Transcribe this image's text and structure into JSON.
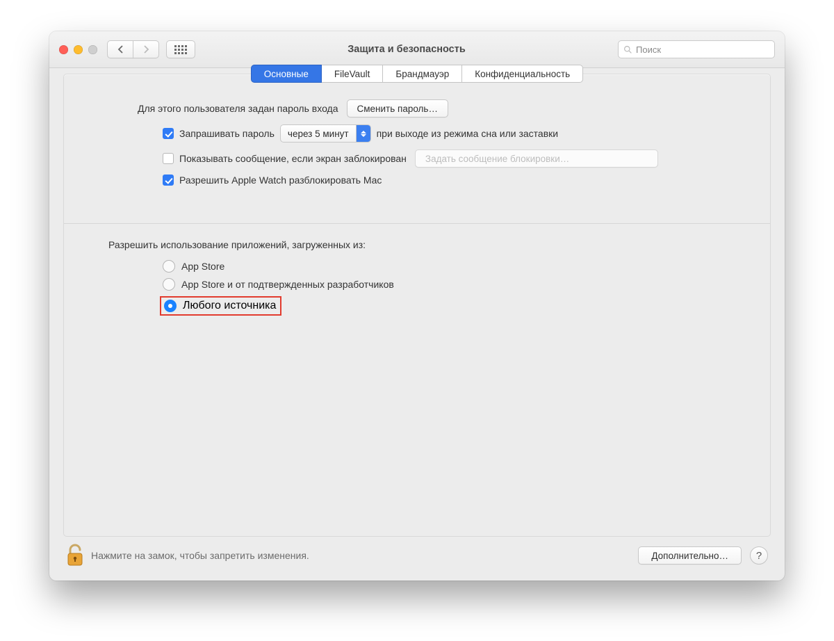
{
  "window": {
    "title": "Защита и безопасность"
  },
  "search": {
    "placeholder": "Поиск"
  },
  "tabs": [
    "Основные",
    "FileVault",
    "Брандмауэр",
    "Конфиденциальность"
  ],
  "general": {
    "password_set_label": "Для этого пользователя задан пароль входа",
    "change_password_button": "Сменить пароль…",
    "require_password_label": "Запрашивать пароль",
    "require_delay": "через 5 минут",
    "require_password_suffix": "при выходе из режима сна или заставки",
    "show_message_label": "Показывать сообщение, если экран заблокирован",
    "set_lock_message_button": "Задать сообщение блокировки…",
    "allow_watch_label": "Разрешить Apple Watch разблокировать Mac"
  },
  "allow_apps": {
    "title": "Разрешить использование приложений, загруженных из:",
    "options": [
      "App Store",
      "App Store и от подтвержденных разработчиков",
      "Любого источника"
    ]
  },
  "footer": {
    "lock_hint": "Нажмите на замок, чтобы запретить изменения.",
    "advanced_button": "Дополнительно…",
    "help": "?"
  }
}
